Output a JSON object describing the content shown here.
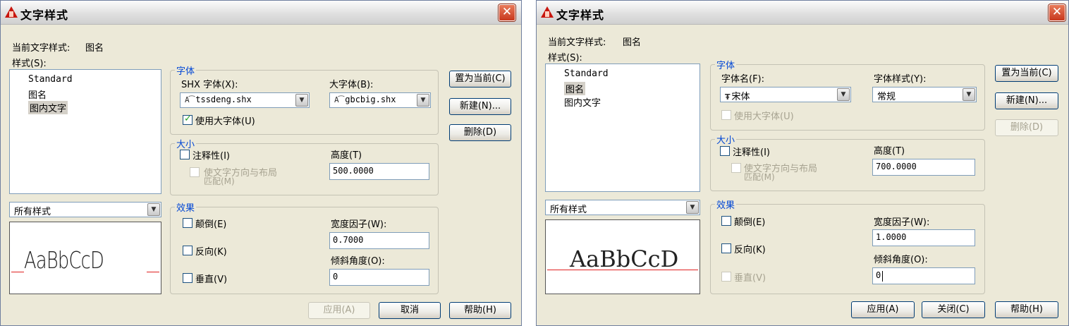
{
  "left": {
    "title": "文字样式",
    "close_glyph": "✕",
    "current_style_label": "当前文字样式:",
    "current_style_value": "图名",
    "styles_label": "样式(S):",
    "styles": [
      "Standard",
      "图名",
      "图内文字"
    ],
    "filter_value": "所有样式",
    "preview_text": "AaBbCcD",
    "font_group": {
      "title": "字体",
      "font_label": "SHX 字体(X):",
      "font_value": "tssdeng.shx",
      "bigfont_label": "大字体(B):",
      "bigfont_value": "gbcbig.shx",
      "use_bigfont_label": "使用大字体(U)",
      "use_bigfont_checked": true
    },
    "size_group": {
      "title": "大小",
      "annotative_label": "注释性(I)",
      "orientation_label_1": "使文字方向与布局",
      "orientation_label_2": "匹配(M)",
      "height_label": "高度(T)",
      "height_value": "500.0000"
    },
    "effects_group": {
      "title": "效果",
      "upside_down_label": "颠倒(E)",
      "backwards_label": "反向(K)",
      "vertical_label": "垂直(V)",
      "width_factor_label": "宽度因子(W):",
      "width_factor_value": "0.7000",
      "oblique_label": "倾斜角度(O):",
      "oblique_value": "0"
    },
    "buttons": {
      "set_current": "置为当前(C)",
      "new": "新建(N)...",
      "delete": "删除(D)",
      "apply": "应用(A)",
      "cancel": "取消",
      "help": "帮助(H)"
    }
  },
  "right": {
    "title": "文字样式",
    "close_glyph": "✕",
    "current_style_label": "当前文字样式:",
    "current_style_value": "图名",
    "styles_label": "样式(S):",
    "styles": [
      "Standard",
      "图名",
      "图内文字"
    ],
    "filter_value": "所有样式",
    "preview_text": "AaBbCcD",
    "font_group": {
      "title": "字体",
      "font_label": "字体名(F):",
      "font_value": "宋体",
      "font_style_label": "字体样式(Y):",
      "font_style_value": "常规",
      "use_bigfont_label": "使用大字体(U)",
      "use_bigfont_checked": false
    },
    "size_group": {
      "title": "大小",
      "annotative_label": "注释性(I)",
      "orientation_label_1": "使文字方向与布局",
      "orientation_label_2": "匹配(M)",
      "height_label": "高度(T)",
      "height_value": "700.0000"
    },
    "effects_group": {
      "title": "效果",
      "upside_down_label": "颠倒(E)",
      "backwards_label": "反向(K)",
      "vertical_label": "垂直(V)",
      "width_factor_label": "宽度因子(W):",
      "width_factor_value": "1.0000",
      "oblique_label": "倾斜角度(O):",
      "oblique_value": "0"
    },
    "buttons": {
      "set_current": "置为当前(C)",
      "new": "新建(N)...",
      "delete": "删除(D)",
      "apply": "应用(A)",
      "close": "关闭(C)",
      "help": "帮助(H)"
    }
  },
  "icons": {
    "shx_font_icon": "A͡",
    "truetype_font_icon": "Ŧ",
    "dropdown_glyph": "▼"
  },
  "colors": {
    "group_title": "#0046d5",
    "dialog_bg": "#ece9d8",
    "close_button": "#c8381e",
    "baseline": "#e02020"
  }
}
